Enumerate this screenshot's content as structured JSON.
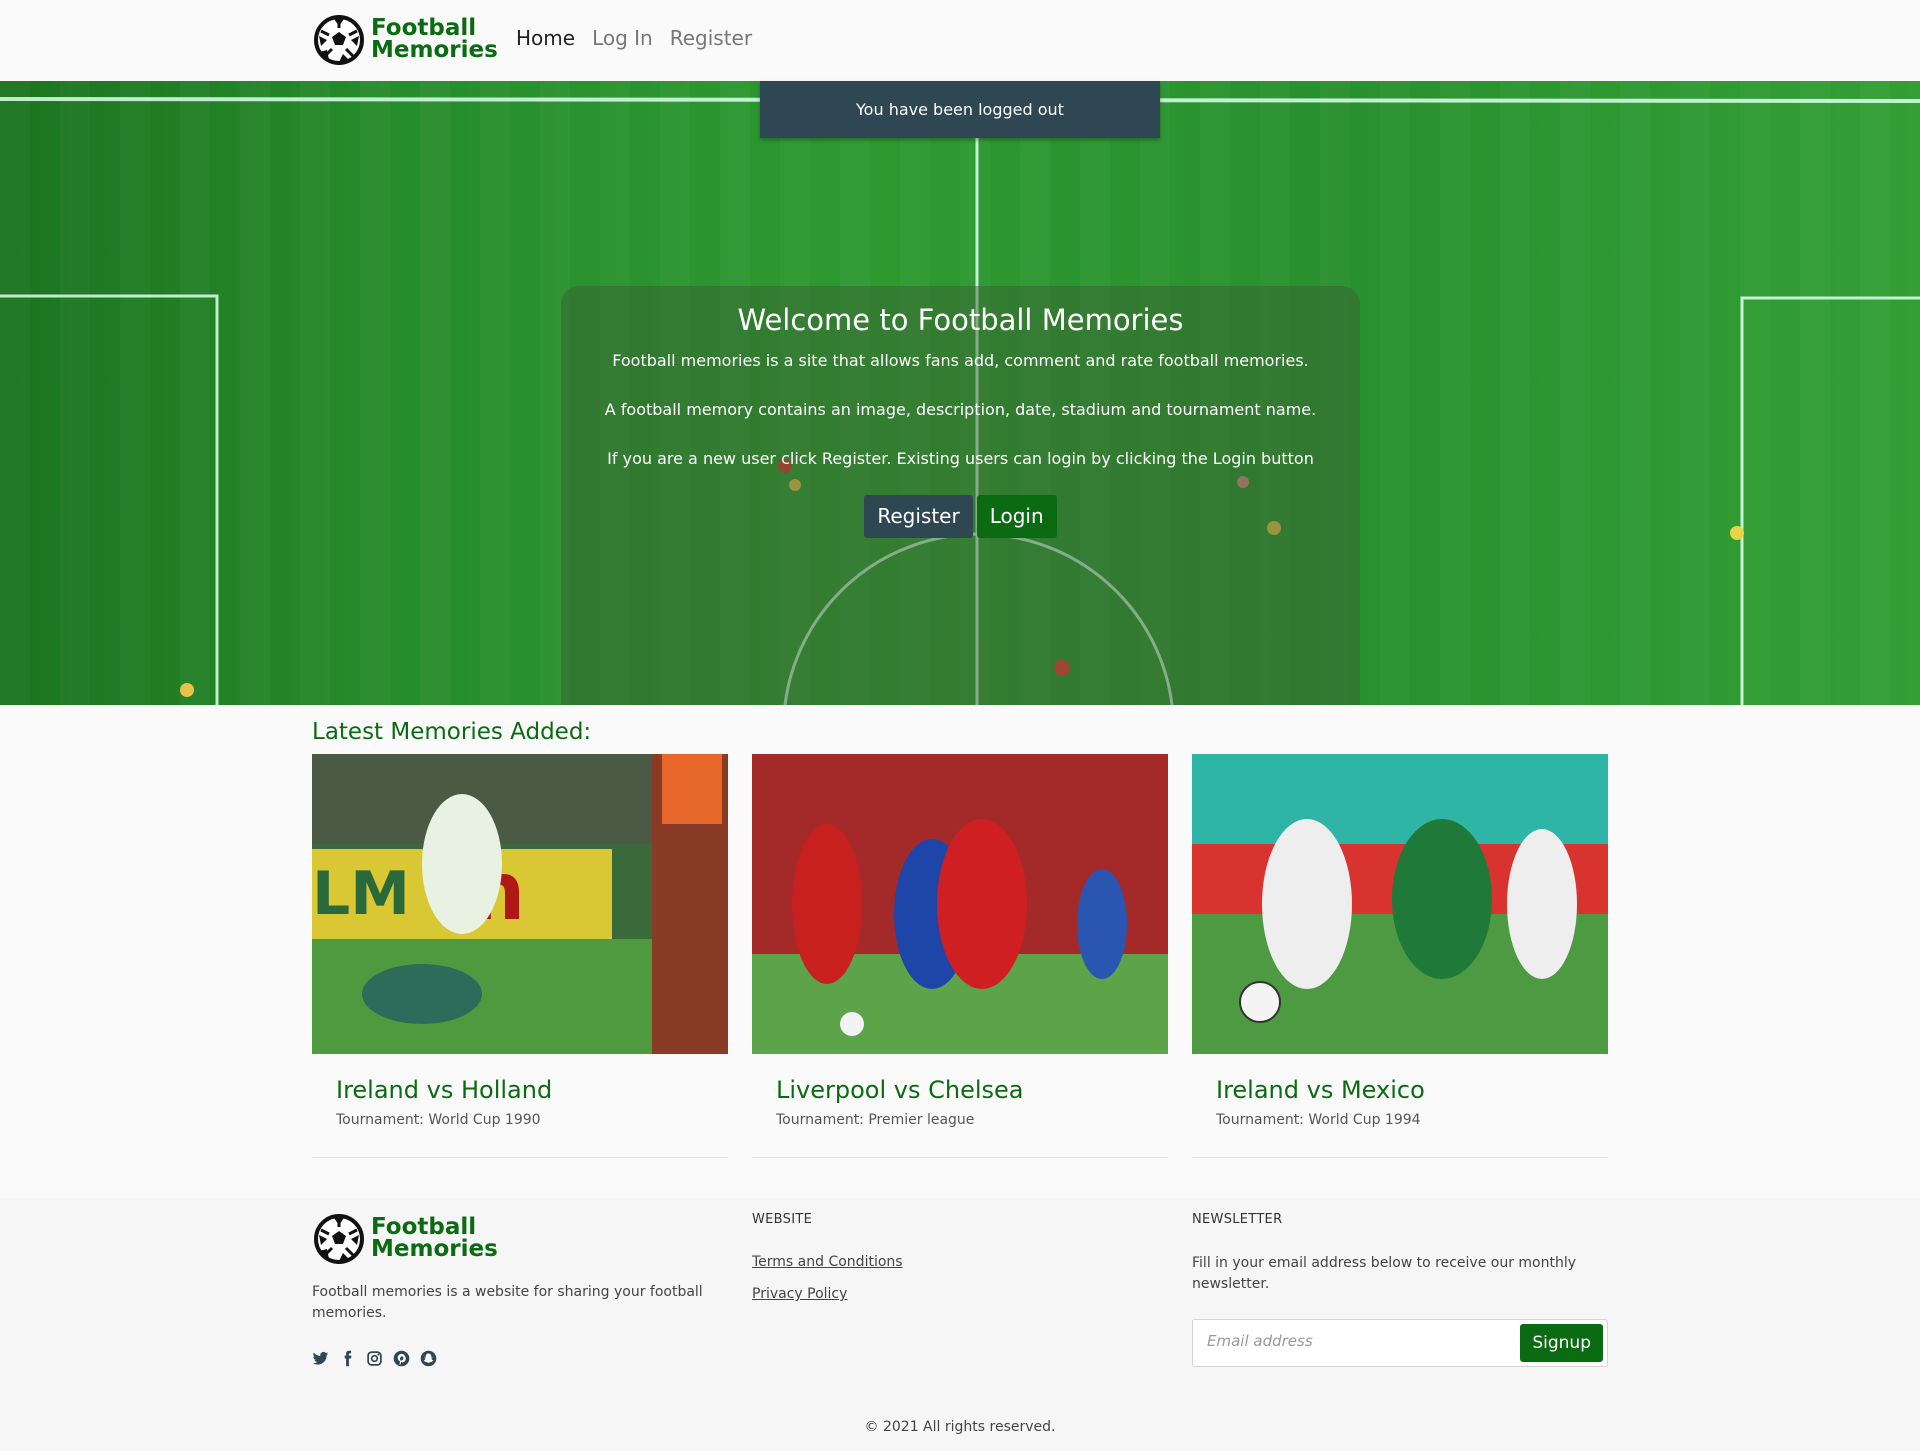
{
  "brand": {
    "line1": "Football",
    "line2": "Memories"
  },
  "nav": {
    "home": "Home",
    "login": "Log In",
    "register": "Register"
  },
  "toast": "You have been logged out",
  "hero": {
    "title": "Welcome to Football Memories",
    "p1": "Football memories is a site that allows fans add, comment and rate football memories.",
    "p2": "A football memory contains an image, description, date, stadium and tournament name.",
    "p3": "If you are a new user click Register. Existing users can login by clicking the Login button",
    "register_btn": "Register",
    "login_btn": "Login"
  },
  "latest": {
    "title": "Latest Memories Added:",
    "cards": [
      {
        "title": "Ireland vs Holland",
        "tournament": "Tournament: World Cup 1990"
      },
      {
        "title": "Liverpool vs Chelsea",
        "tournament": "Tournament: Premier league"
      },
      {
        "title": "Ireland vs Mexico",
        "tournament": "Tournament: World Cup 1994"
      }
    ]
  },
  "footer": {
    "description": "Football memories is a website for sharing your football memories.",
    "website_heading": "WEBSITE",
    "terms": "Terms and Conditions",
    "privacy": "Privacy Policy",
    "newsletter_heading": "NEWSLETTER",
    "newsletter_text": "Fill in your email address below to receive our monthly newsletter.",
    "email_placeholder": "Email address",
    "signup": "Signup",
    "copyright": "© 2021 All rights reserved.",
    "social_icons": [
      "twitter-icon",
      "facebook-icon",
      "instagram-icon",
      "pinterest-icon",
      "snapchat-icon"
    ]
  },
  "colors": {
    "brand_green": "#0b6b12",
    "dark_slate": "#2f4653",
    "pitch_green": "#2a9530"
  }
}
